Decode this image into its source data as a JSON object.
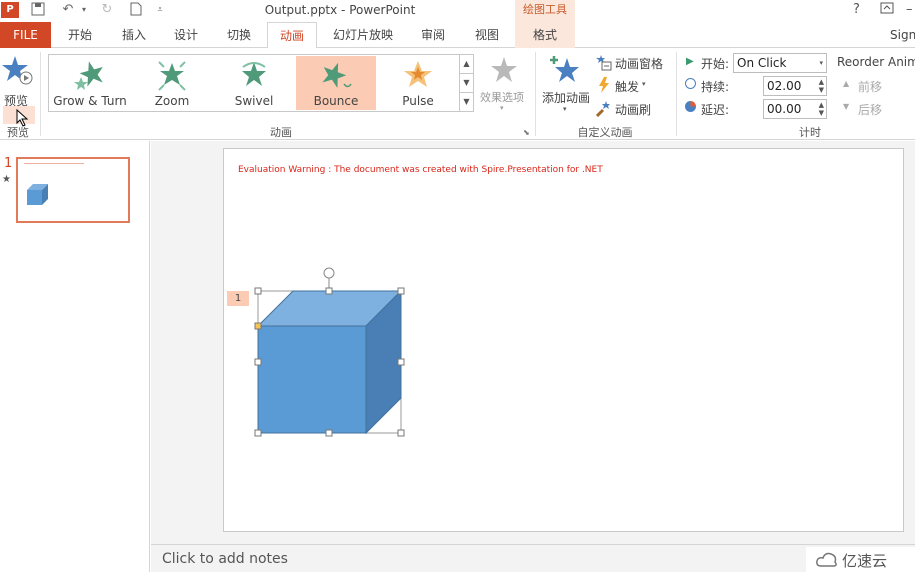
{
  "titlebar": {
    "doc_title": "Output.pptx - PowerPoint",
    "contextual_header": "绘图工具",
    "help": "?",
    "restore": "⌅"
  },
  "tabs": {
    "file": "FILE",
    "items": [
      "开始",
      "插入",
      "设计",
      "切换",
      "动画",
      "幻灯片放映",
      "审阅",
      "视图",
      "格式"
    ],
    "sign_in": "Sign"
  },
  "ribbon": {
    "preview": {
      "button": "预览",
      "group": "预览"
    },
    "animation_group": "动画",
    "gallery": [
      {
        "label": "Grow & Turn"
      },
      {
        "label": "Zoom"
      },
      {
        "label": "Swivel"
      },
      {
        "label": "Bounce"
      },
      {
        "label": "Pulse"
      }
    ],
    "effect_options": "效果选项",
    "add_animation": "添加动画",
    "animation_pane": "动画窗格",
    "trigger": "触发",
    "painter": "动画刷",
    "custom_group": "自定义动画",
    "timing": {
      "start_label": "开始:",
      "start_value": "On Click",
      "duration_label": "持续:",
      "duration_value": "02.00",
      "delay_label": "延迟:",
      "delay_value": "00.00",
      "group": "计时",
      "reorder": "Reorder Anima",
      "move_earlier": "前移",
      "move_later": "后移"
    }
  },
  "slides": {
    "number": "1",
    "star": "★"
  },
  "slide": {
    "warning": "Evaluation Warning : The document was created with  Spire.Presentation for .NET",
    "anim_tag": "1"
  },
  "notes": {
    "placeholder": "Click to add notes"
  },
  "watermark": {
    "text": "亿速云"
  },
  "colors": {
    "accent": "#d24726",
    "cube_front": "#5b9bd5",
    "cube_top": "#7eb0e0",
    "cube_side": "#4a7fb5"
  }
}
